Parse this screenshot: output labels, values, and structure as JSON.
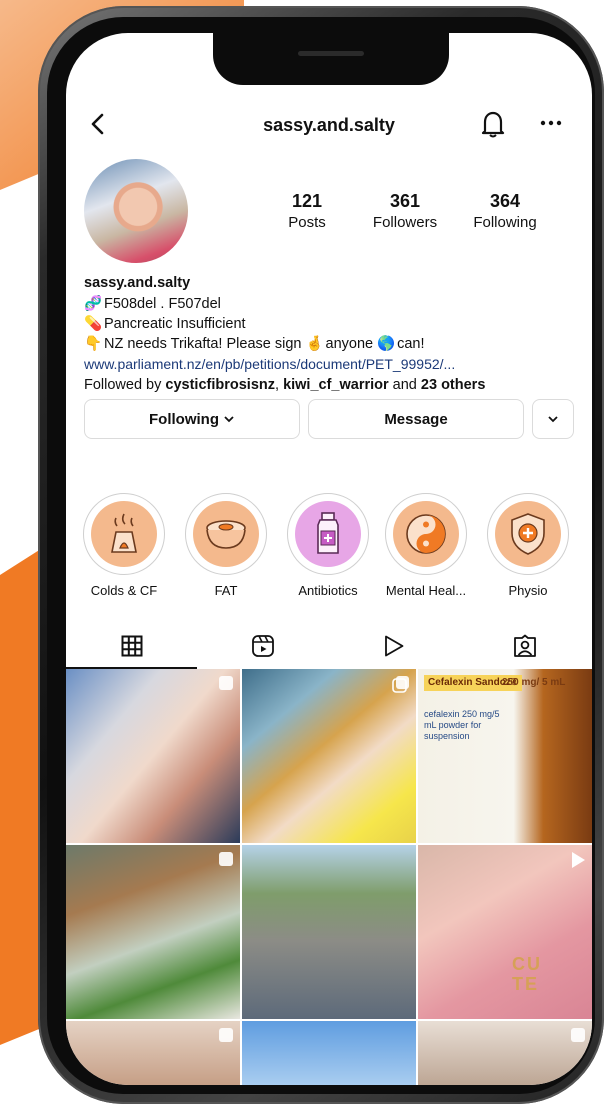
{
  "colors": {
    "accent_orange": "#f07a24",
    "link": "#1c3a78",
    "text": "#111111",
    "border": "#dbdbdb"
  },
  "header": {
    "username": "sassy.and.salty",
    "back_icon": "chevron-left-icon",
    "bell_icon": "bell-icon",
    "more_icon": "more-horizontal-icon"
  },
  "stats": [
    {
      "value": "121",
      "label": "Posts"
    },
    {
      "value": "361",
      "label": "Followers"
    },
    {
      "value": "364",
      "label": "Following"
    }
  ],
  "bio": {
    "name": "sassy.and.salty",
    "line1": "F508del . F507del",
    "line1_emoji": "🧬",
    "line2": "Pancreatic Insufficient",
    "line2_emoji": "💊",
    "line3_a": "NZ needs Trikafta! Please sign",
    "line3_b": "anyone",
    "line3_c": "can!",
    "line3_emoji1": "👇",
    "line3_emoji2": "🤞",
    "line3_emoji3": "🌎",
    "link": "www.parliament.nz/en/pb/petitions/document/PET_99952/...",
    "followed_prefix": "Followed by",
    "followed_user1": "cysticfibrosisnz",
    "followed_user2": "kiwi_cf_warrior",
    "followed_and": "and",
    "followed_others": "23 others"
  },
  "actions": {
    "following_label": "Following",
    "message_label": "Message"
  },
  "highlights": [
    {
      "label": "Colds & CF",
      "icon": "diffuser-icon",
      "tint": "#f4b98d"
    },
    {
      "label": "FAT",
      "icon": "bowl-icon",
      "tint": "#f4b98d"
    },
    {
      "label": "Antibiotics",
      "icon": "medicine-bottle-icon",
      "tint": "#e7a6e6"
    },
    {
      "label": "Mental Heal...",
      "icon": "yin-yang-icon",
      "tint": "#f4b98d"
    },
    {
      "label": "Physio",
      "icon": "shield-cross-icon",
      "tint": "#f4b98d"
    }
  ],
  "tabs": [
    {
      "name": "grid",
      "icon": "grid-icon"
    },
    {
      "name": "reels",
      "icon": "reels-icon"
    },
    {
      "name": "videos",
      "icon": "play-icon"
    },
    {
      "name": "tagged",
      "icon": "tagged-user-icon"
    }
  ],
  "post_texts": {
    "cefalexin_brand": "Cefalexin Sandoz®",
    "cefalexin_dose": "250 mg/ 5 mL",
    "cefalexin_sub": "cefalexin 250 mg/5 mL powder for suspension",
    "shirt_text_1": "CU",
    "shirt_text_2": "TE"
  }
}
